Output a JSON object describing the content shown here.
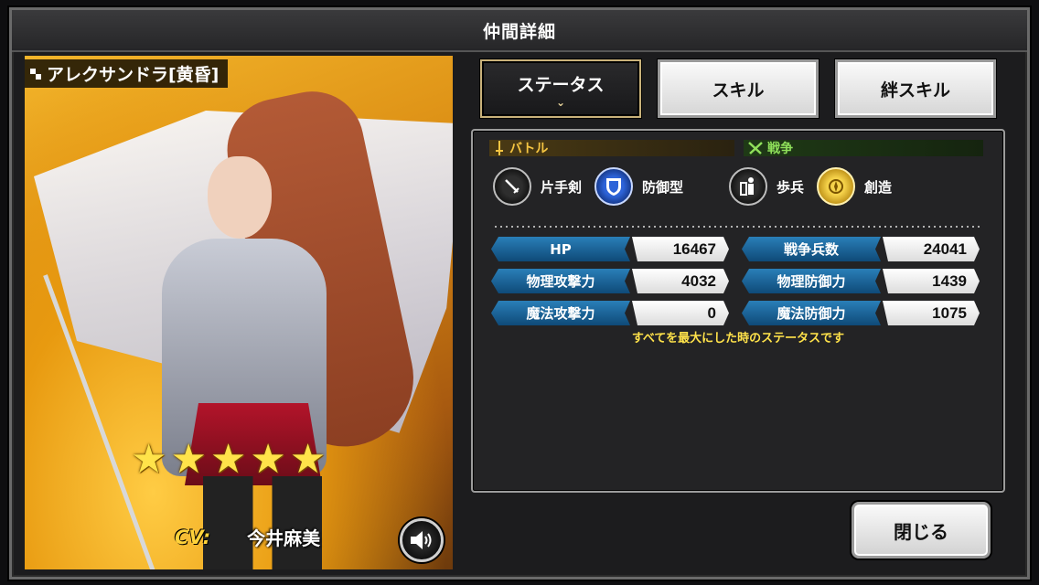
{
  "window": {
    "title": "仲間詳細"
  },
  "character": {
    "name": "アレクサンドラ[黄昏]",
    "rarity_stars": 5,
    "cv_label": "CV:",
    "cv_name": "今井麻美"
  },
  "tabs": [
    {
      "label": "ステータス",
      "active": true
    },
    {
      "label": "スキル",
      "active": false
    },
    {
      "label": "絆スキル",
      "active": false
    }
  ],
  "sections": {
    "battle": {
      "label": "バトル",
      "icon": "sword-icon"
    },
    "war": {
      "label": "戦争",
      "icon": "crossed-swords-icon"
    }
  },
  "attributes": [
    {
      "icon": "one-handed-sword-icon",
      "label": "片手剣"
    },
    {
      "icon": "shield-icon",
      "label": "防御型"
    },
    {
      "icon": "infantry-icon",
      "label": "歩兵"
    },
    {
      "icon": "creation-emblem-icon",
      "label": "創造"
    }
  ],
  "stats": {
    "hp": {
      "label": "HP",
      "value": "16467"
    },
    "war_troops": {
      "label": "戦争兵数",
      "value": "24041"
    },
    "phys_atk": {
      "label": "物理攻撃力",
      "value": "4032"
    },
    "phys_def": {
      "label": "物理防御力",
      "value": "1439"
    },
    "mag_atk": {
      "label": "魔法攻撃力",
      "value": "0"
    },
    "mag_def": {
      "label": "魔法防御力",
      "value": "1075"
    }
  },
  "note": "すべてを最大にした時のステータスです",
  "buttons": {
    "close": "閉じる"
  },
  "colors": {
    "accent_gold": "#ffd23a",
    "stat_label_blue": "#1a6aa0",
    "battle_gold": "#f5c542",
    "war_green": "#8fe05a"
  }
}
